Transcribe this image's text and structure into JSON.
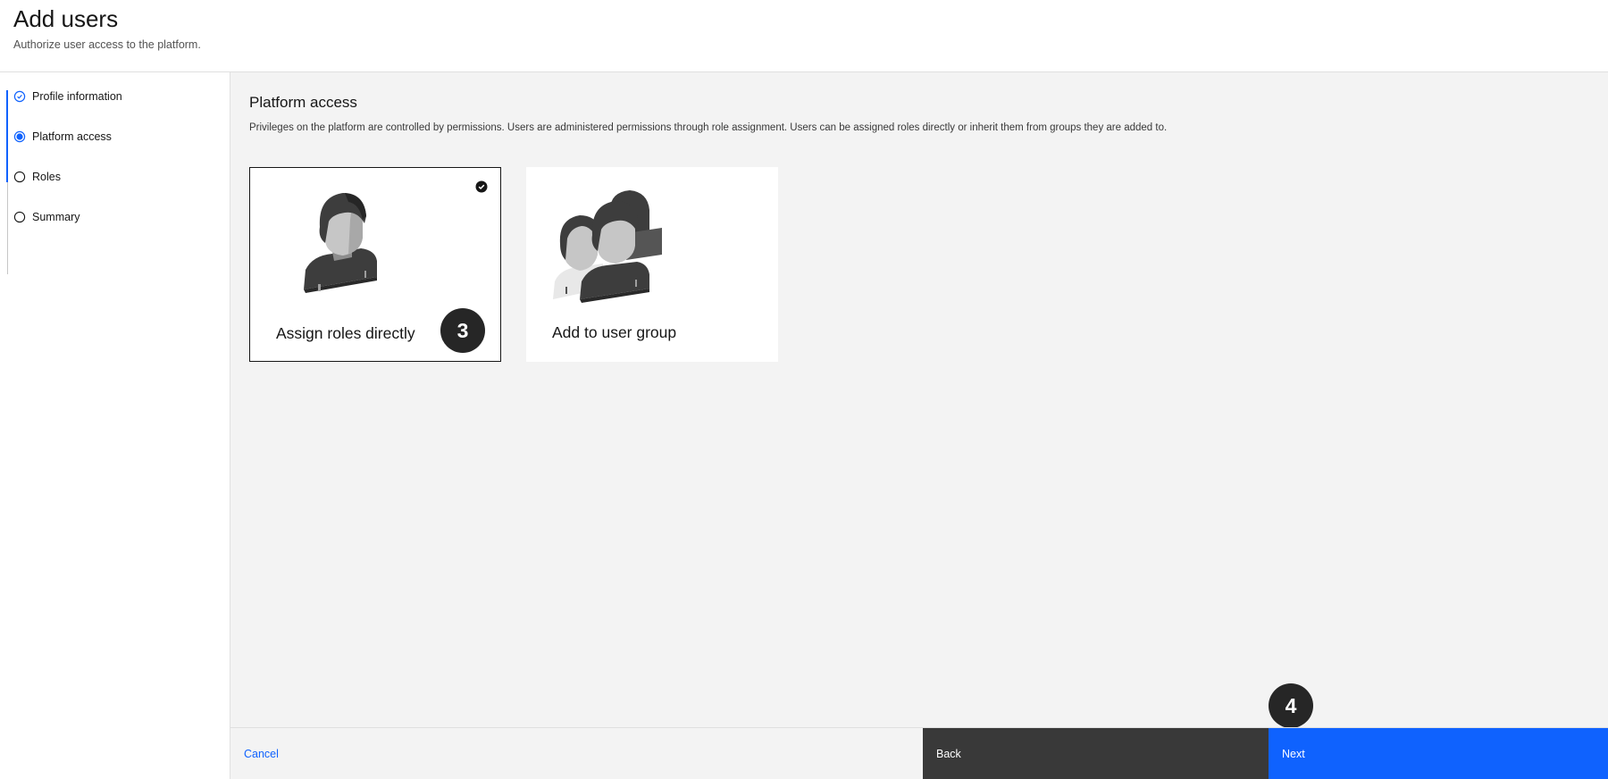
{
  "header": {
    "title": "Add users",
    "subtitle": "Authorize user access to the platform."
  },
  "steps": [
    {
      "label": "Profile information",
      "state": "complete",
      "icon": "checkmark-circle-icon"
    },
    {
      "label": "Platform access",
      "state": "current",
      "icon": "filled-circle-icon"
    },
    {
      "label": "Roles",
      "state": "incomplete",
      "icon": "empty-circle-icon"
    },
    {
      "label": "Summary",
      "state": "incomplete",
      "icon": "empty-circle-icon"
    }
  ],
  "main": {
    "title": "Platform access",
    "description": "Privileges on the platform are controlled by permissions. Users are administered permissions through role assignment. Users can be assigned roles directly or inherit them from groups they are added to.",
    "tiles": [
      {
        "label": "Assign roles directly",
        "selected": true,
        "icon": "single-user-icon"
      },
      {
        "label": "Add to user group",
        "selected": false,
        "icon": "user-group-icon"
      }
    ]
  },
  "markers": [
    "3",
    "4"
  ],
  "footer": {
    "cancel_label": "Cancel",
    "back_label": "Back",
    "next_label": "Next"
  },
  "colors": {
    "accent": "#0f62fe",
    "back_button": "#393939",
    "surface": "#f3f3f3"
  }
}
